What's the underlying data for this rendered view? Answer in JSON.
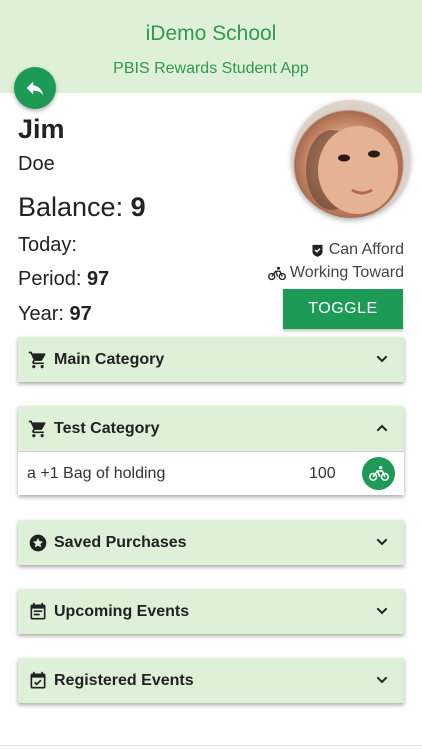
{
  "header": {
    "title": "iDemo School",
    "subtitle": "PBIS Rewards Student App"
  },
  "student": {
    "first_name": "Jim",
    "last_name": "Doe"
  },
  "balance": {
    "label": "Balance: ",
    "value": "9"
  },
  "stats": {
    "today_label": "Today:",
    "period_label": "Period: ",
    "period_value": "97",
    "year_label": "Year: ",
    "year_value": "97"
  },
  "legend": {
    "can_afford": "Can Afford",
    "working_toward": "Working Toward"
  },
  "toggle_label": "TOGGLE",
  "panels": [
    {
      "title": "Main Category",
      "icon": "cart-icon",
      "expanded": false
    },
    {
      "title": "Test Category",
      "icon": "cart-icon",
      "expanded": true,
      "items": [
        {
          "name": "a +1 Bag of holding",
          "price": "100",
          "status": "working-toward"
        }
      ]
    },
    {
      "title": "Saved Purchases",
      "icon": "star-icon",
      "expanded": false
    },
    {
      "title": "Upcoming Events",
      "icon": "calendar-icon",
      "expanded": false
    },
    {
      "title": "Registered Events",
      "icon": "calendar-check-icon",
      "expanded": false
    }
  ],
  "colors": {
    "accent": "#1e9a57",
    "header_bg": "#dff0d8",
    "header_text": "#2e9a4e"
  }
}
